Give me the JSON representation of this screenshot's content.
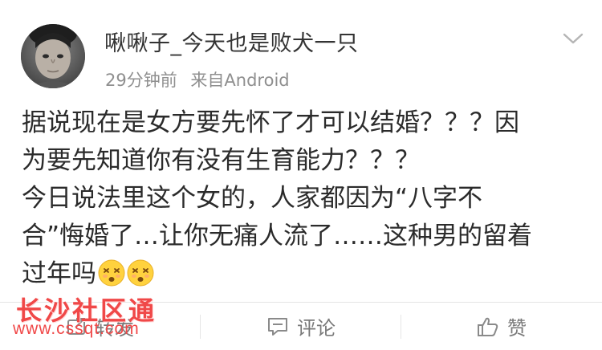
{
  "post": {
    "username": "啾啾子_今天也是败犬一只",
    "time": "29分钟前",
    "source": "来自Android",
    "content_lines": [
      "据说现在是女方要先怀了才可以结婚？？？因",
      "为要先知道你有没有生育能力？？？",
      "今日说法里这个女的，人家都因为“八字不",
      "合”悔婚了…让你无痛人流了……这种男的留着",
      "过年吗"
    ],
    "emojis": [
      "dizzy-face-emoji",
      "dizzy-face-emoji"
    ]
  },
  "actions": {
    "repost_label": "转发",
    "comment_label": "评论",
    "like_label": "赞"
  },
  "watermark": {
    "title": "长沙社区通",
    "url": "www.cssqt.com"
  },
  "colors": {
    "text": "#2b2b2b",
    "meta": "#8f8f8f",
    "watermark": "#f04848"
  }
}
